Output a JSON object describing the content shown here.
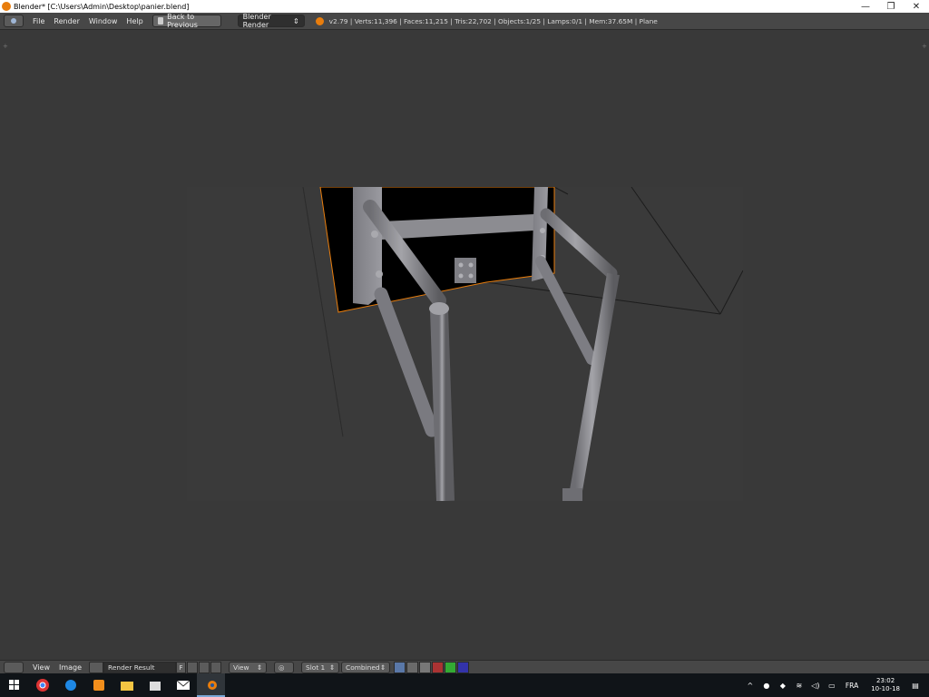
{
  "window": {
    "title": "Blender* [C:\\Users\\Admin\\Desktop\\panier.blend]",
    "controls": [
      "—",
      "❐",
      "✕"
    ]
  },
  "info_header": {
    "menus": [
      "File",
      "Render",
      "Window",
      "Help"
    ],
    "back_button": "Back to Previous",
    "render_engine": "Blender Render",
    "stats": "v2.79 | Verts:11,396 | Faces:11,215 | Tris:22,702 | Objects:1/25 | Lamps:0/1 | Mem:37.65M | Plane"
  },
  "image_editor_header": {
    "menus": [
      "View",
      "Image"
    ],
    "image_name": "Render Result",
    "fake_user": "F",
    "view_dropdown": "View",
    "slot_dropdown": "Slot 1",
    "pass_dropdown": "Combined"
  },
  "taskbar": {
    "apps": [
      "windows-start",
      "chrome",
      "edge",
      "sublime",
      "file-explorer",
      "store",
      "mail",
      "blender"
    ],
    "language": "FRA",
    "time": "23:02",
    "date": "10-10-18"
  },
  "colors": {
    "background": "#393939",
    "header": "#474747",
    "selection_outline": "#e87d0d",
    "pipe": "#8a8a8f"
  }
}
